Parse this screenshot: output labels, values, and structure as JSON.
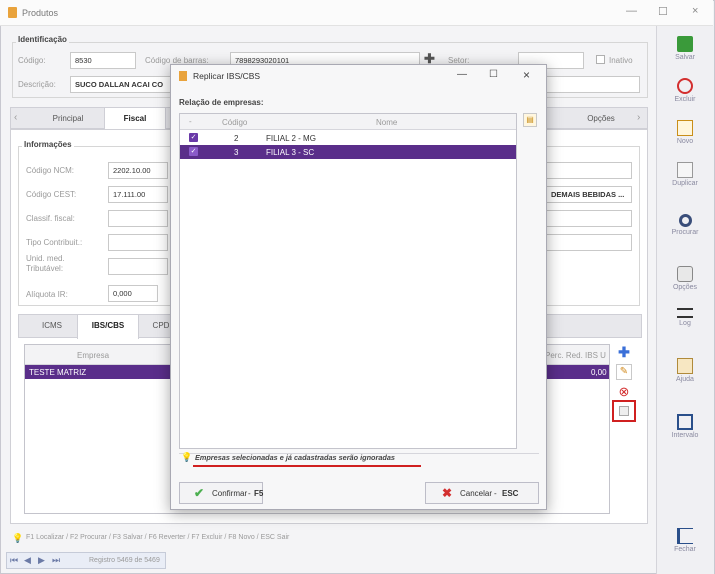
{
  "window": {
    "title": "Produtos",
    "controls": [
      "—",
      "☐",
      "×"
    ]
  },
  "identificacao": {
    "legend": "Identificação",
    "codigo_label": "Código:",
    "codigo_value": "8530",
    "barras_label": "Código de barras:",
    "barras_value": "7898293020101",
    "setor_label": "Setor:",
    "inativo_label": "Inativo",
    "descricao_label": "Descrição:",
    "descricao_value": "SUCO DALLAN ACAI CO"
  },
  "main_tabs": [
    "Principal",
    "Fiscal",
    "Opções"
  ],
  "informacoes": {
    "legend": "Informações",
    "ncm_label": "Código NCM:",
    "ncm_value": "2202.10.00",
    "cest_label": "Código CEST:",
    "cest_value": "17.111.00",
    "classif_label": "Classif. fiscal:",
    "tipo_label": "Tipo Contribuit.:",
    "unid_label": "Unid. med. Tributável:",
    "aliquota_label": "Alíquota IR:",
    "aliquota_value": "0,000",
    "cest_desc": "DEMAIS BEBIDAS ..."
  },
  "sub_tabs": [
    "ICMS",
    "IBS/CBS",
    "CPD"
  ],
  "sub_grid": {
    "col_empresa": "Empresa",
    "col_red": "Perc. Red. IBS U",
    "row_empresa": "TESTE MATRIZ",
    "row_value": "0,00"
  },
  "status_bar": "F1 Localizar / F2 Procurar / F3 Salvar / F6 Reverter / F7 Excluir / F8 Novo / ESC Sair",
  "nav": {
    "record": "Registro 5469 de 5469"
  },
  "right_toolbar": [
    "Salvar",
    "Excluir",
    "Novo",
    "Duplicar",
    "Procurar",
    "Opções",
    "Log",
    "Ajuda",
    "Intervalo",
    "Fechar"
  ],
  "dialog": {
    "title": "Replicar IBS/CBS",
    "controls": [
      "—",
      "☐",
      "×"
    ],
    "section_label": "Relação de empresas:",
    "col_codigo": "Código",
    "col_nome": "Nome",
    "rows": [
      {
        "codigo": "2",
        "nome": "FILIAL 2 - MG",
        "checked": true
      },
      {
        "codigo": "3",
        "nome": "FILIAL 3 - SC",
        "checked": true
      }
    ],
    "note": "Empresas selecionadas e já cadastradas serão ignoradas",
    "confirm_label": "Confirmar",
    "confirm_key": "F5",
    "cancel_label": "Cancelar",
    "cancel_key": "ESC"
  },
  "colors": {
    "accent": "#5b2d8e",
    "highlight_row": "#5a2e8a",
    "underline_red": "#d02020",
    "nav_blue": "#e9edf6"
  }
}
